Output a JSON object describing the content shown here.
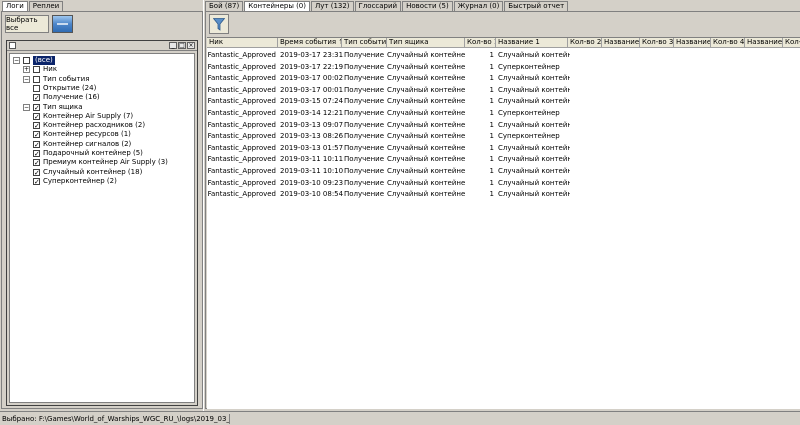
{
  "left_tabs": [
    "Логи",
    "Реплеи"
  ],
  "select_all_label": "Выбрать все",
  "tree": {
    "root": "(все)",
    "items": [
      {
        "label": "Ник",
        "level": 1,
        "expander": "+",
        "checked": false
      },
      {
        "label": "Тип события",
        "level": 1,
        "expander": "-",
        "checked": false
      },
      {
        "label": "Открытие (24)",
        "level": 2,
        "checked": false
      },
      {
        "label": "Получение (16)",
        "level": 2,
        "checked": true
      },
      {
        "label": "Тип ящика",
        "level": 1,
        "expander": "-",
        "checked": true
      },
      {
        "label": "Контейнер Air Supply (7)",
        "level": 2,
        "checked": true
      },
      {
        "label": "Контейнер расходников (2)",
        "level": 2,
        "checked": true
      },
      {
        "label": "Контейнер ресурсов (1)",
        "level": 2,
        "checked": true
      },
      {
        "label": "Контейнер сигналов (2)",
        "level": 2,
        "checked": true
      },
      {
        "label": "Подарочный контейнер (5)",
        "level": 2,
        "checked": true
      },
      {
        "label": "Премиум контейнер Air Supply (3)",
        "level": 2,
        "checked": true
      },
      {
        "label": "Случайный контейнер (18)",
        "level": 2,
        "checked": true
      },
      {
        "label": "Суперконтейнер (2)",
        "level": 2,
        "checked": true
      }
    ]
  },
  "right_tabs": [
    "Бой (87)",
    "Контейнеры (0)",
    "Лут (132)",
    "Глоссарий",
    "Новости (5)",
    "Журнал (0)",
    "Быстрый отчет"
  ],
  "active_right_tab": 1,
  "columns": [
    "Ник",
    "Время события ↑",
    "Тип события",
    "Тип ящика",
    "Кол-во 1",
    "Название 1",
    "Кол-во 2",
    "Название 2",
    "Кол-во 3",
    "Название 3",
    "Кол-во 4",
    "Название 4",
    "Кол-во 5"
  ],
  "rows": [
    {
      "nick": "Fantastic_Approved",
      "time": "2019-03-17 23:31:10",
      "event": "Получение",
      "box": "Случайный контейнер",
      "qty": "1",
      "name": "Случайный контейнер"
    },
    {
      "nick": "Fantastic_Approved",
      "time": "2019-03-17 22:19:46",
      "event": "Получение",
      "box": "Случайный контейнер",
      "qty": "1",
      "name": "Суперконтейнер"
    },
    {
      "nick": "Fantastic_Approved",
      "time": "2019-03-17 00:02:04",
      "event": "Получение",
      "box": "Случайный контейнер",
      "qty": "1",
      "name": "Случайный контейнер"
    },
    {
      "nick": "Fantastic_Approved",
      "time": "2019-03-17 00:01:47",
      "event": "Получение",
      "box": "Случайный контейнер",
      "qty": "1",
      "name": "Случайный контейнер"
    },
    {
      "nick": "Fantastic_Approved",
      "time": "2019-03-15 07:24:00",
      "event": "Получение",
      "box": "Случайный контейнер",
      "qty": "1",
      "name": "Случайный контейнер"
    },
    {
      "nick": "Fantastic_Approved",
      "time": "2019-03-14 12:21:29",
      "event": "Получение",
      "box": "Случайный контейнер",
      "qty": "1",
      "name": "Суперконтейнер"
    },
    {
      "nick": "Fantastic_Approved",
      "time": "2019-03-13 09:07:45",
      "event": "Получение",
      "box": "Случайный контейнер",
      "qty": "1",
      "name": "Случайный контейнер"
    },
    {
      "nick": "Fantastic_Approved",
      "time": "2019-03-13 08:26:47",
      "event": "Получение",
      "box": "Случайный контейнер",
      "qty": "1",
      "name": "Суперконтейнер"
    },
    {
      "nick": "Fantastic_Approved",
      "time": "2019-03-13 01:57:47",
      "event": "Получение",
      "box": "Случайный контейнер",
      "qty": "1",
      "name": "Случайный контейнер"
    },
    {
      "nick": "Fantastic_Approved",
      "time": "2019-03-11 10:11:19",
      "event": "Получение",
      "box": "Случайный контейнер",
      "qty": "1",
      "name": "Случайный контейнер"
    },
    {
      "nick": "Fantastic_Approved",
      "time": "2019-03-11 10:10:41",
      "event": "Получение",
      "box": "Случайный контейнер",
      "qty": "1",
      "name": "Случайный контейнер"
    },
    {
      "nick": "Fantastic_Approved",
      "time": "2019-03-10 09:23:22",
      "event": "Получение",
      "box": "Случайный контейнер",
      "qty": "1",
      "name": "Случайный контейнер"
    },
    {
      "nick": "Fantastic_Approved",
      "time": "2019-03-10 08:54:57",
      "event": "Получение",
      "box": "Случайный контейнер",
      "qty": "1",
      "name": "Случайный контейнер"
    }
  ],
  "status_text": "Выбрано: F:\\Games\\World_of_Warships_WGC_RU_\\logs\\2019_03_10-08_30_38 20"
}
